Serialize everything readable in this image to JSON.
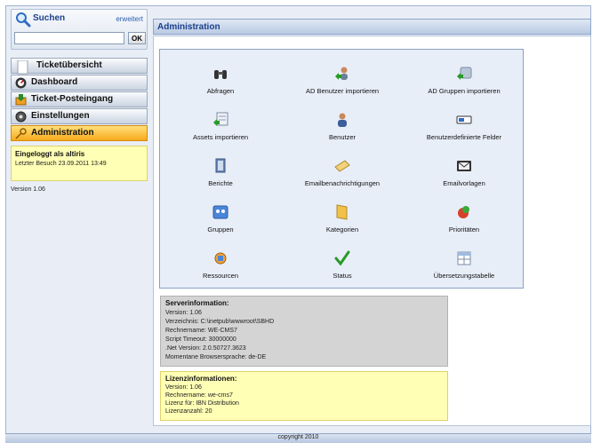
{
  "search": {
    "title": "Suchen",
    "advanced_label": "erweitert",
    "input_value": "",
    "ok_label": "OK"
  },
  "nav": {
    "items": [
      {
        "label": "Ticketübersicht",
        "icon": "document-icon",
        "active": false
      },
      {
        "label": "Dashboard",
        "icon": "dashboard-icon",
        "active": false
      },
      {
        "label": "Ticket-Posteingang",
        "icon": "inbox-icon",
        "active": false
      },
      {
        "label": "Einstellungen",
        "icon": "gear-icon",
        "active": false
      },
      {
        "label": "Administration",
        "icon": "key-icon",
        "active": true
      }
    ]
  },
  "login": {
    "title": "Eingeloggt als altiris",
    "last_visit": "Letzter Besuch 23.09.2011 13:49"
  },
  "version_text": "Version 1.06",
  "main": {
    "title": "Administration"
  },
  "admin_items": [
    {
      "label": "Abfragen",
      "icon": "binoculars-icon"
    },
    {
      "label": "AD Benutzer importieren",
      "icon": "user-import-icon"
    },
    {
      "label": "AD Gruppen importieren",
      "icon": "group-import-icon"
    },
    {
      "label": "Assets importieren",
      "icon": "asset-import-icon"
    },
    {
      "label": "Benutzer",
      "icon": "user-icon"
    },
    {
      "label": "Benutzerdefinierte Felder",
      "icon": "field-icon"
    },
    {
      "label": "Berichte",
      "icon": "report-icon"
    },
    {
      "label": "Emailbenachrichtigungen",
      "icon": "email-notify-icon"
    },
    {
      "label": "Emailvorlagen",
      "icon": "email-template-icon"
    },
    {
      "label": "Gruppen",
      "icon": "group-icon"
    },
    {
      "label": "Kategorien",
      "icon": "folder-icon"
    },
    {
      "label": "Prioritäten",
      "icon": "priority-icon"
    },
    {
      "label": "Ressourcen",
      "icon": "resources-icon"
    },
    {
      "label": "Status",
      "icon": "checkmark-icon"
    },
    {
      "label": "Übersetzungstabelle",
      "icon": "table-icon"
    }
  ],
  "server_info": {
    "title": "Serverinformation:",
    "lines": [
      "Version: 1.06",
      "Verzeichnis: C:\\inetpub\\wwwroot\\SBHD",
      "Rechnername: WE-CMS7",
      "Script Timeout: 30000000",
      ".Net Version: 2.0.50727.3623",
      "Momentane Browsersprache: de-DE"
    ]
  },
  "license_info": {
    "title": "Lizenzinformationen:",
    "lines": [
      "Version: 1.06",
      "Rechnername: we-cms7",
      "Lizenz für: IBN Distribution",
      "Lizenzanzahl: 20"
    ]
  },
  "footer": {
    "text": "copyright 2010"
  },
  "colors": {
    "header_text": "#1b3f8c",
    "active_nav": "#f6a91c",
    "info_yellow": "#ffffb5",
    "server_gray": "#d4d4d4"
  }
}
